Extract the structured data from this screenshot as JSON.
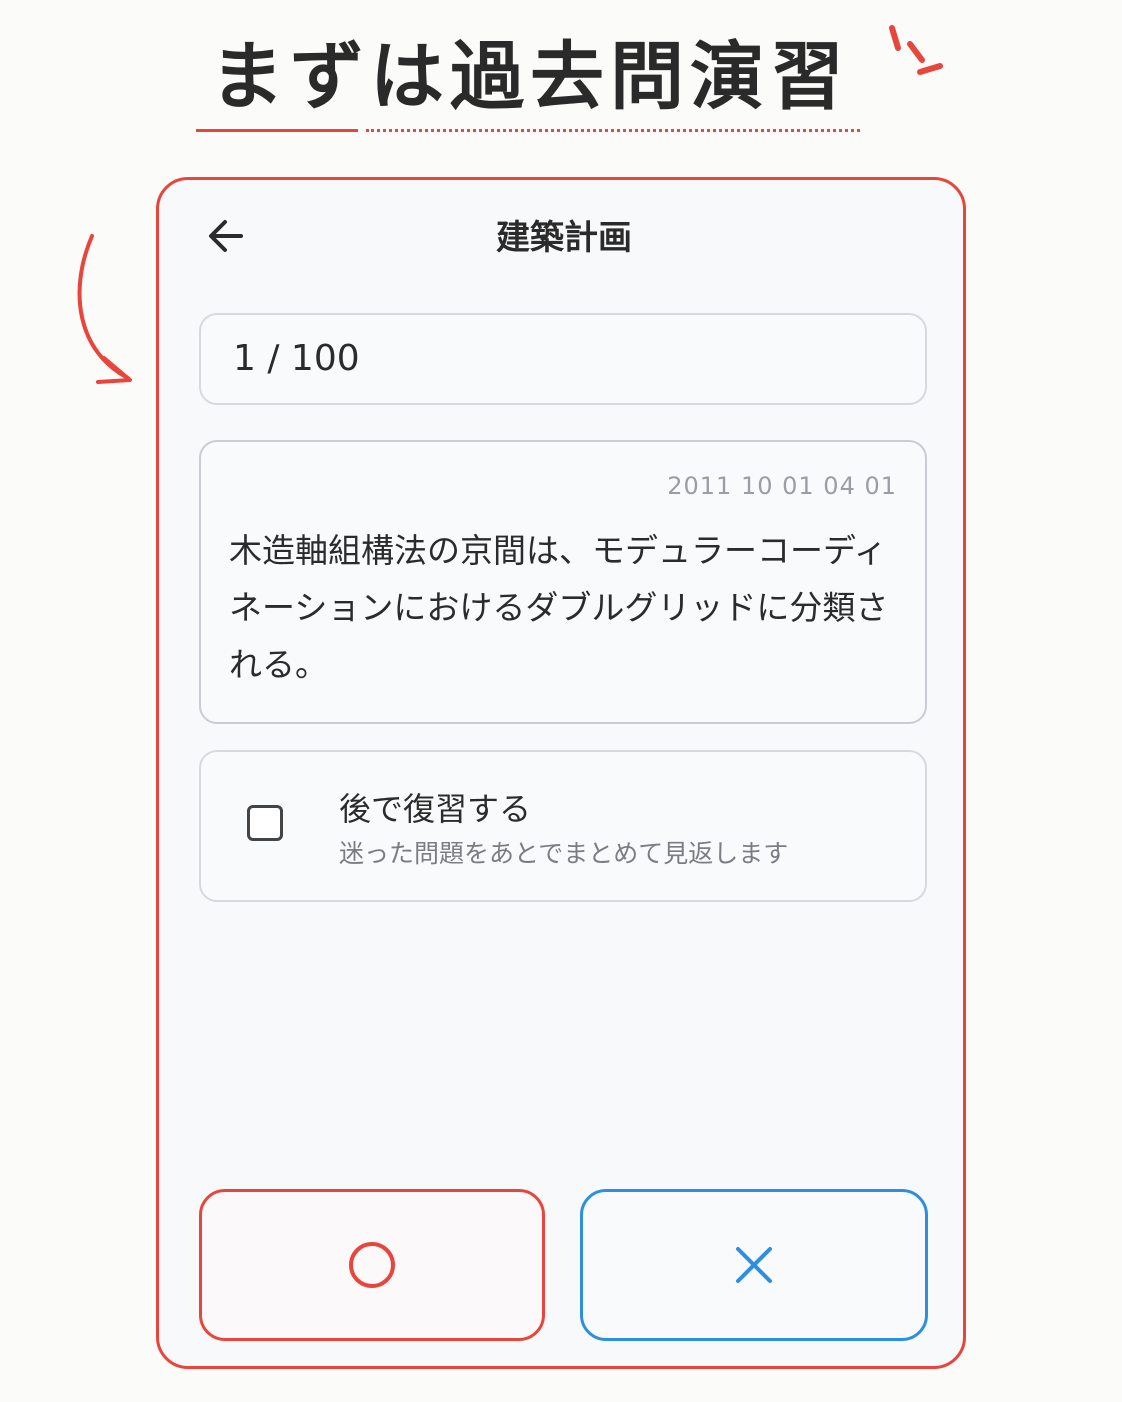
{
  "headline": "まずは過去問演習",
  "colors": {
    "accent_red": "#e8453c",
    "accent_blue": "#2e8fe0"
  },
  "app": {
    "title": "建築計画",
    "back_icon": "arrow-left-icon",
    "counter": "1 / 100",
    "question": {
      "id": "2011 10 01 04 01",
      "text": "木造軸組構法の京間は、モデュラーコーディネーションにおけるダブルグリッドに分類される。"
    },
    "review": {
      "checked": false,
      "title": "後で復習する",
      "subtitle": "迷った問題をあとでまとめて見返します"
    },
    "answer_buttons": {
      "correct_icon": "circle-icon",
      "wrong_icon": "cross-icon"
    }
  }
}
